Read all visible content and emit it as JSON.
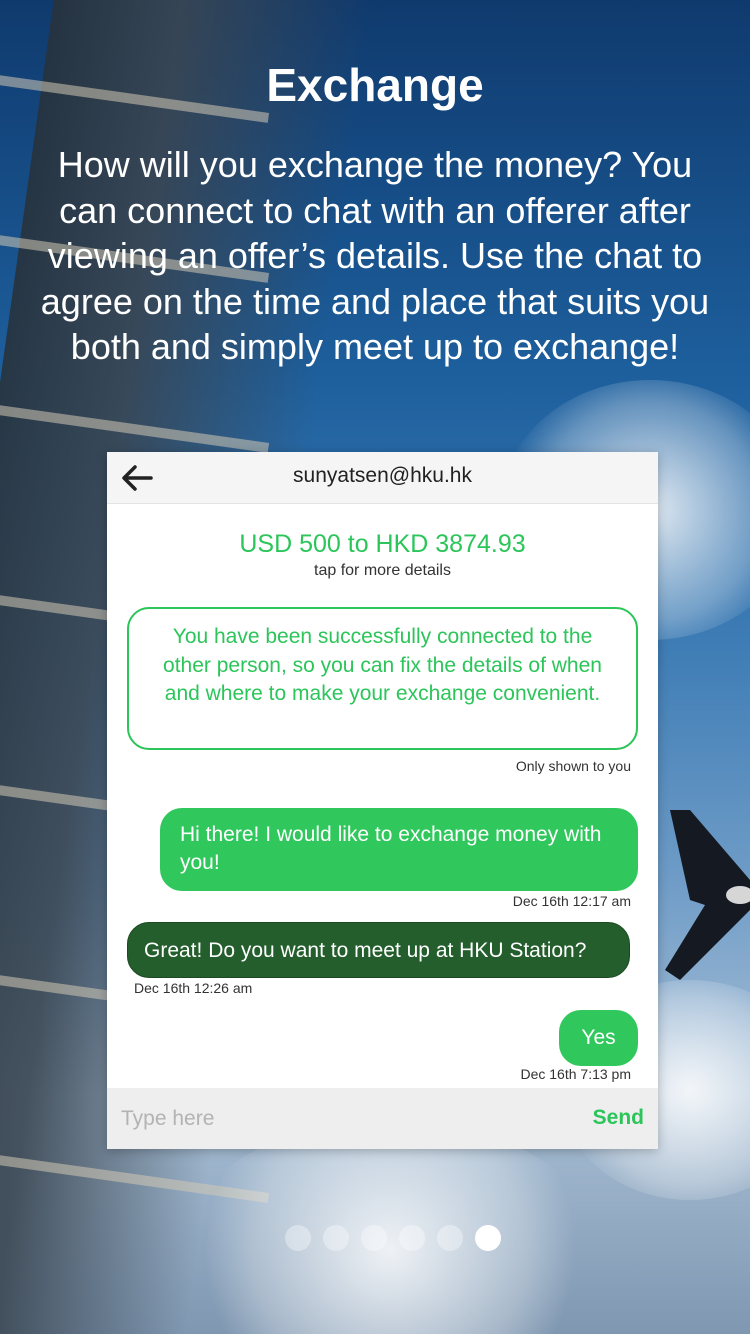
{
  "header": {
    "title": "Exchange",
    "description": "How will you exchange the money? You can connect to chat with an offerer after viewing an offer’s details. Use the chat to agree on the time and place that suits you both and simply meet up to exchange!"
  },
  "chat": {
    "back_icon": "arrow-left-icon",
    "contact_email": "sunyatsen@hku.hk",
    "offer_summary": "USD 500 to HKD 3874.93",
    "offer_hint": "tap for more details",
    "system_message": "You have been successfully connected to the other person, so you can fix the details of when and where to make your exchange convenient.",
    "system_note": "Only shown to you",
    "messages": [
      {
        "sender": "me",
        "text": "Hi there! I would like to exchange money with you!",
        "time": "Dec 16th 12:17 am"
      },
      {
        "sender": "other",
        "text": "Great! Do you want to meet up at HKU Station?",
        "time": "Dec 16th 12:26 am"
      },
      {
        "sender": "me",
        "text": "Yes",
        "time": "Dec 16th 7:13 pm"
      }
    ],
    "input_placeholder": "Type here",
    "send_label": "Send"
  },
  "pagination": {
    "total": 6,
    "active_index": 5
  },
  "colors": {
    "accent_green": "#2cc55a",
    "bubble_me": "#30c85c",
    "bubble_other": "#245e2d",
    "input_bar": "#eeeeee"
  }
}
